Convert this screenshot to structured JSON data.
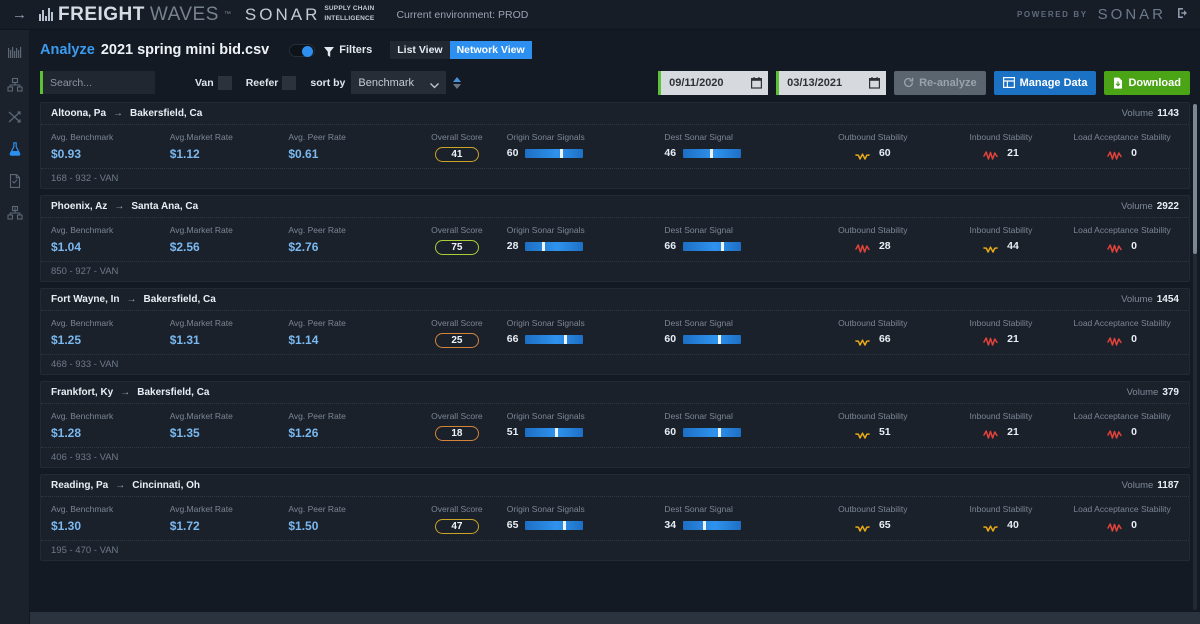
{
  "topbar": {
    "arrow_icon": "arrow-right-icon",
    "brand_freight": "FREIGHT",
    "brand_waves": "WAVES",
    "brand_tm": "™",
    "sonar_word": "SONAR",
    "sonar_sub_line1": "SUPPLY CHAIN",
    "sonar_sub_line2": "INTELLIGENCE",
    "environment": "Current environment: PROD",
    "powered_by": "POWERED BY",
    "powered_sonar": "SONAR",
    "logout_icon": "logout-icon"
  },
  "sidebar": {
    "items": [
      {
        "name": "barcode-chart-icon",
        "label": "Lane Signals"
      },
      {
        "name": "org-chart-icon",
        "label": "Network"
      },
      {
        "name": "shuffle-arrows-icon",
        "label": "Routing"
      },
      {
        "name": "flask-icon",
        "label": "Analyze",
        "active": true
      },
      {
        "name": "document-check-icon",
        "label": "Reports"
      },
      {
        "name": "dollar-org-chart-icon",
        "label": "Rates"
      }
    ]
  },
  "toolbar": {
    "analyze_word": "Analyze",
    "file_name": "2021 spring mini bid.csv",
    "filters_toggle_on": true,
    "filters_label": "Filters",
    "views": [
      {
        "label": "List View",
        "active": false
      },
      {
        "label": "Network View",
        "active": true
      }
    ],
    "search_placeholder": "Search...",
    "search_value": "",
    "checkboxes": [
      {
        "label": "Van",
        "checked": false
      },
      {
        "label": "Reefer",
        "checked": false
      }
    ],
    "sort_by_label": "sort by",
    "sort_by_value": "Benchmark",
    "date_start": "09/11/2020",
    "date_end": "03/13/2021",
    "btn_reanalyze": "Re-analyze",
    "btn_manage": "Manage Data",
    "btn_download": "Download"
  },
  "column_labels": {
    "benchmark": "Avg. Benchmark",
    "market": "Avg.Market Rate",
    "peer": "Avg. Peer Rate",
    "score": "Overall Score",
    "origin_signal": "Origin Sonar Signals",
    "dest_signal": "Dest Sonar Signal",
    "outbound": "Outbound Stability",
    "inbound": "Inbound Stability",
    "load_accept": "Load Acceptance Stability",
    "volume": "Volume"
  },
  "colors": {
    "accent_blue": "#2d8ff0",
    "value_blue": "#7ab8ef",
    "score_gold": "#caa327",
    "score_green": "#a8cf38",
    "score_orange": "#d4843a",
    "wave_yellow": "#e8a917",
    "wave_red": "#e1423a",
    "green_accent": "#5bc236",
    "download_green": "#4ba316",
    "manage_blue": "#1b72c4"
  },
  "cards": [
    {
      "origin": "Altoona, Pa",
      "dest": "Bakersfield, Ca",
      "volume": "1143",
      "benchmark": "$0.93",
      "market": "$1.12",
      "peer": "$0.61",
      "score": "41",
      "score_color": "#caa327",
      "origin_signal": "60",
      "origin_pct": 60,
      "dest_signal": "46",
      "dest_pct": 46,
      "outbound": "60",
      "outbound_color": "#e8a917",
      "inbound": "21",
      "inbound_color": "#e1423a",
      "load_accept": "0",
      "load_color": "#e1423a",
      "footer": "168 - 932 - VAN"
    },
    {
      "origin": "Phoenix, Az",
      "dest": "Santa Ana, Ca",
      "volume": "2922",
      "benchmark": "$1.04",
      "market": "$2.56",
      "peer": "$2.76",
      "score": "75",
      "score_color": "#a8cf38",
      "origin_signal": "28",
      "origin_pct": 28,
      "dest_signal": "66",
      "dest_pct": 66,
      "outbound": "28",
      "outbound_color": "#e1423a",
      "inbound": "44",
      "inbound_color": "#e8a917",
      "load_accept": "0",
      "load_color": "#e1423a",
      "footer": "850 - 927 - VAN"
    },
    {
      "origin": "Fort Wayne, In",
      "dest": "Bakersfield, Ca",
      "volume": "1454",
      "benchmark": "$1.25",
      "market": "$1.31",
      "peer": "$1.14",
      "score": "25",
      "score_color": "#d4843a",
      "origin_signal": "66",
      "origin_pct": 66,
      "dest_signal": "60",
      "dest_pct": 60,
      "outbound": "66",
      "outbound_color": "#e8a917",
      "inbound": "21",
      "inbound_color": "#e1423a",
      "load_accept": "0",
      "load_color": "#e1423a",
      "footer": "468 - 933 - VAN"
    },
    {
      "origin": "Frankfort, Ky",
      "dest": "Bakersfield, Ca",
      "volume": "379",
      "benchmark": "$1.28",
      "market": "$1.35",
      "peer": "$1.26",
      "score": "18",
      "score_color": "#d4843a",
      "origin_signal": "51",
      "origin_pct": 51,
      "dest_signal": "60",
      "dest_pct": 60,
      "outbound": "51",
      "outbound_color": "#e8a917",
      "inbound": "21",
      "inbound_color": "#e1423a",
      "load_accept": "0",
      "load_color": "#e1423a",
      "footer": "406 - 933 - VAN"
    },
    {
      "origin": "Reading, Pa",
      "dest": "Cincinnati, Oh",
      "volume": "1187",
      "benchmark": "$1.30",
      "market": "$1.72",
      "peer": "$1.50",
      "score": "47",
      "score_color": "#caa327",
      "origin_signal": "65",
      "origin_pct": 65,
      "dest_signal": "34",
      "dest_pct": 34,
      "outbound": "65",
      "outbound_color": "#e8a917",
      "inbound": "40",
      "inbound_color": "#e8a917",
      "load_accept": "0",
      "load_color": "#e1423a",
      "footer": "195 - 470 - VAN"
    }
  ]
}
